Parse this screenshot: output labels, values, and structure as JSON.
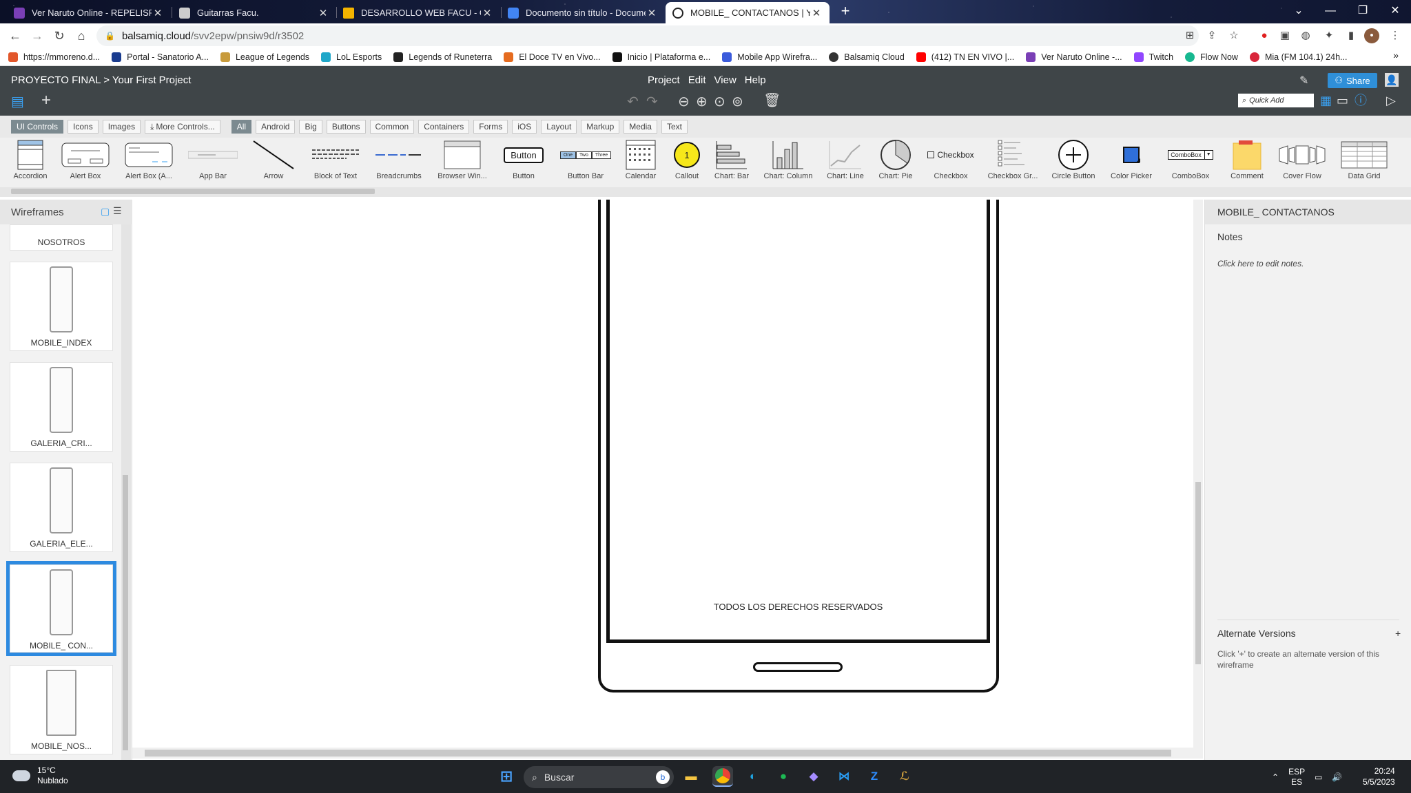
{
  "browser": {
    "tabs": [
      {
        "title": "Ver Naruto Online - REPELISPLUS",
        "color": "#7a3fb6"
      },
      {
        "title": "Guitarras Facu.",
        "color": "#cccccc"
      },
      {
        "title": "DESARROLLO WEB FACU - Goog",
        "color": "#f4b400"
      },
      {
        "title": "Documento sin título - Documen",
        "color": "#4285f4"
      },
      {
        "title": "MOBILE_ CONTACTANOS | Your F",
        "color": "#222222",
        "active": true
      }
    ],
    "url_host": "balsamiq.cloud",
    "url_path": "/svv2epw/pnsiw9d/r3502",
    "bookmarks": [
      {
        "label": "https://mmoreno.d...",
        "color": "#e2572b"
      },
      {
        "label": "Portal - Sanatorio A...",
        "color": "#1a3c8f"
      },
      {
        "label": "League of Legends",
        "color": "#c89b3c"
      },
      {
        "label": "LoL Esports",
        "color": "#1fa7c9"
      },
      {
        "label": "Legends of Runeterra",
        "color": "#222222"
      },
      {
        "label": "El Doce TV en Vivo...",
        "color": "#e56b1f"
      },
      {
        "label": "Inicio | Plataforma e...",
        "color": "#111111"
      },
      {
        "label": "Mobile App Wirefra...",
        "color": "#3b5bdb"
      },
      {
        "label": "Balsamiq Cloud",
        "color": "#333333"
      },
      {
        "label": "(412) TN EN VIVO |...",
        "color": "#ff0000"
      },
      {
        "label": "Ver Naruto Online -...",
        "color": "#7a3fb6"
      },
      {
        "label": "Twitch",
        "color": "#9146ff"
      },
      {
        "label": "Flow Now",
        "color": "#17b890"
      },
      {
        "label": "Mia (FM 104.1) 24h...",
        "color": "#d9263b"
      }
    ],
    "bookmarks_more": "»"
  },
  "app": {
    "project": "PROYECTO FINAL",
    "separator": ">",
    "document": "Your First Project",
    "menus": [
      "Project",
      "Edit",
      "View",
      "Help"
    ],
    "share_label": "Share",
    "quick_add_placeholder": "Quick Add"
  },
  "library": {
    "tabs": [
      "UI Controls",
      "Icons",
      "Images",
      "More Controls..."
    ],
    "categories": [
      "All",
      "Android",
      "Big",
      "Buttons",
      "Common",
      "Containers",
      "Forms",
      "iOS",
      "Layout",
      "Markup",
      "Media",
      "Text"
    ],
    "items": [
      "Accordion",
      "Alert Box",
      "Alert Box (A...",
      "App Bar",
      "Arrow",
      "Block of Text",
      "Breadcrumbs",
      "Browser Win...",
      "Button",
      "Button Bar",
      "Calendar",
      "Callout",
      "Chart: Bar",
      "Chart: Column",
      "Chart: Line",
      "Chart: Pie",
      "Checkbox",
      "Checkbox Gr...",
      "Circle Button",
      "Color Picker",
      "ComboBox",
      "Comment",
      "Cover Flow",
      "Data Grid"
    ],
    "button_text": "Button",
    "checkbox_text": "Checkbox",
    "combobox_text": "ComboBox",
    "callout_text": "1",
    "buttonbar_items": [
      "One",
      "Two",
      "Three"
    ]
  },
  "navigator": {
    "title": "Wireframes",
    "pages": [
      "NOSOTROS",
      "MOBILE_INDEX",
      "GALERIA_CRI...",
      "GALERIA_ELE...",
      "MOBILE_ CON...",
      "MOBILE_NOS..."
    ],
    "selected_index": 4
  },
  "canvas": {
    "footer_text": "TODOS LOS DERECHOS RESERVADOS"
  },
  "inspector": {
    "title": "MOBILE_ CONTACTANOS",
    "notes_label": "Notes",
    "notes_placeholder": "Click here to edit notes.",
    "alt_title": "Alternate Versions",
    "alt_plus": "+",
    "alt_help": "Click '+' to create an alternate version of this wireframe"
  },
  "taskbar": {
    "temperature": "15°C",
    "weather": "Nublado",
    "search_placeholder": "Buscar",
    "lang_top": "ESP",
    "lang_bottom": "ES",
    "time": "20:24",
    "date": "5/5/2023"
  }
}
